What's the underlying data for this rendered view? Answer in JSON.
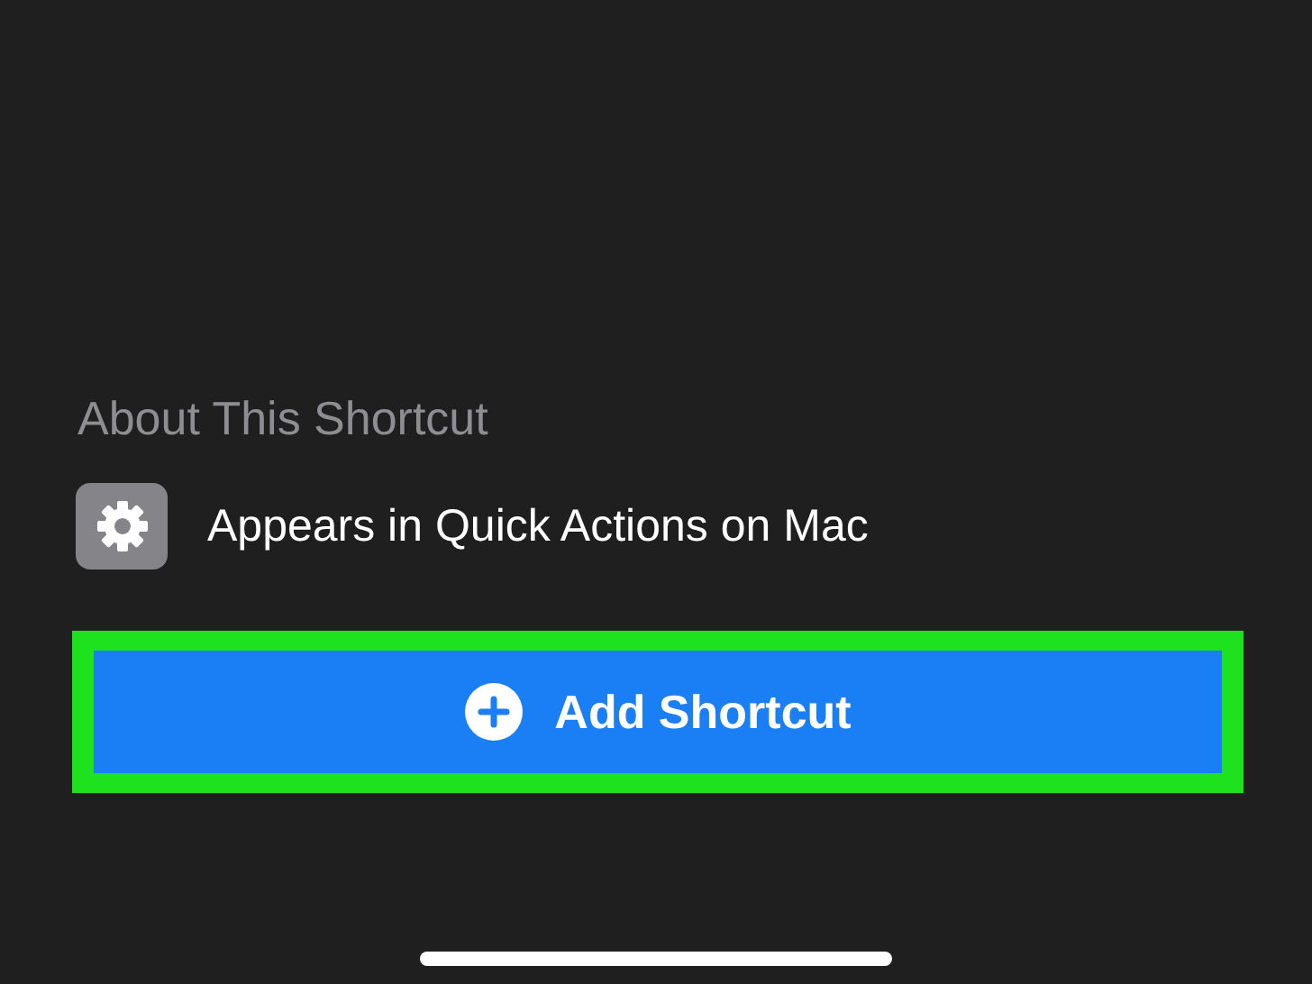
{
  "section": {
    "title": "About This Shortcut"
  },
  "info_row": {
    "text": "Appears in Quick Actions on Mac"
  },
  "primary_button": {
    "label": "Add Shortcut",
    "highlighted": true
  }
}
